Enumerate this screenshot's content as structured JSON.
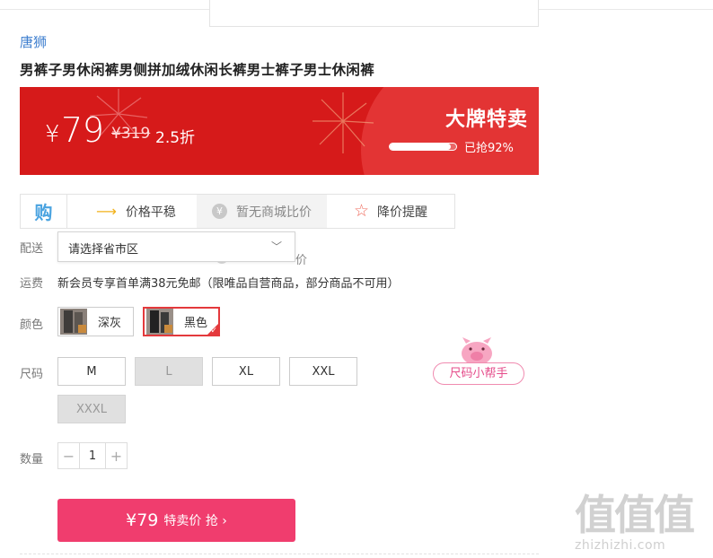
{
  "product": {
    "brand": "唐狮",
    "title": "男裤子男休闲裤男侧拼加绒休闲长裤男士裤子男士休闲裤"
  },
  "banner": {
    "currency": "¥",
    "price": "79",
    "original_price": "¥319",
    "discount": "2.5折",
    "sale_title": "大牌特卖",
    "sold_label": "已抢92%",
    "sold_fraction": 0.92,
    "color": "#d61a1a"
  },
  "tools": {
    "gou_icon": "购",
    "trend_label": "价格平稳",
    "compare_label": "暂无商城比价",
    "remind_label": "降价提醒"
  },
  "delivery": {
    "label": "配送",
    "region_placeholder": "请选择省市区",
    "hidden_suffix": "价"
  },
  "shipping": {
    "label": "运费",
    "text": "新会员专享首单满38元免邮（限唯品自营商品，部分商品不可用）"
  },
  "color": {
    "label": "颜色",
    "options": [
      {
        "name": "深灰",
        "selected": false
      },
      {
        "name": "黑色",
        "selected": true
      }
    ]
  },
  "size": {
    "label": "尺码",
    "options": [
      {
        "name": "M",
        "available": true
      },
      {
        "name": "L",
        "available": false
      },
      {
        "name": "XL",
        "available": true
      },
      {
        "name": "XXL",
        "available": true
      },
      {
        "name": "XXXL",
        "available": false
      }
    ],
    "helper_label": "尺码小帮手"
  },
  "quantity": {
    "label": "数量",
    "value": "1",
    "minus": "−",
    "plus": "+"
  },
  "buy": {
    "price": "¥79",
    "label": "特卖价 抢 ›",
    "color": "#f03d6e"
  },
  "watermark": {
    "logo": "值值值",
    "url": "zhizhizhi.com"
  }
}
